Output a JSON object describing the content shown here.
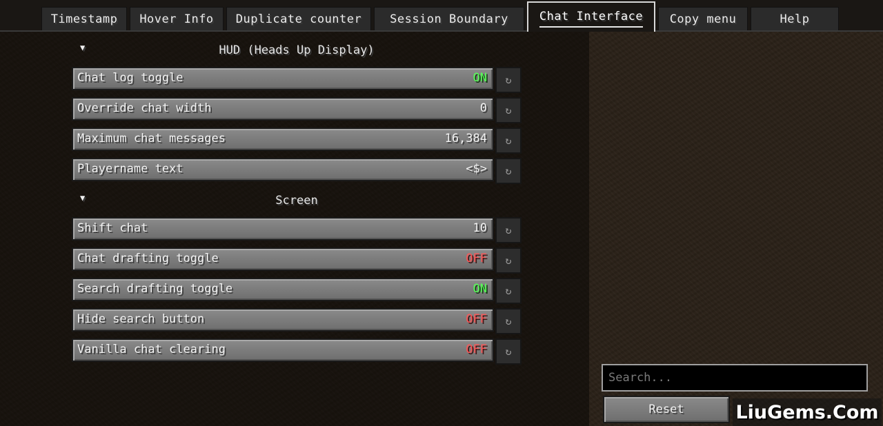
{
  "tabs": [
    {
      "label": "Timestamp"
    },
    {
      "label": "Hover Info"
    },
    {
      "label": "Duplicate counter"
    },
    {
      "label": "Session Boundary"
    },
    {
      "label": "Chat Interface"
    },
    {
      "label": "Copy menu"
    },
    {
      "label": "Help"
    }
  ],
  "active_tab": "Chat Interface",
  "sections": [
    {
      "title": "HUD (Heads Up Display)",
      "options": [
        {
          "label": "Chat log toggle",
          "value": "ON",
          "state": "on"
        },
        {
          "label": "Override chat width",
          "value": "0",
          "state": "plain"
        },
        {
          "label": "Maximum chat messages",
          "value": "16,384",
          "state": "plain"
        },
        {
          "label": "Playername text",
          "value": "<$>",
          "state": "plain"
        }
      ]
    },
    {
      "title": "Screen",
      "options": [
        {
          "label": "Shift chat",
          "value": "10",
          "state": "plain"
        },
        {
          "label": "Chat drafting toggle",
          "value": "OFF",
          "state": "off"
        },
        {
          "label": "Search drafting toggle",
          "value": "ON",
          "state": "on"
        },
        {
          "label": "Hide search button",
          "value": "OFF",
          "state": "off"
        },
        {
          "label": "Vanilla chat clearing",
          "value": "OFF",
          "state": "off"
        }
      ]
    }
  ],
  "icons": {
    "collapse": "triangle-down-icon",
    "reset": "reset-icon"
  },
  "search": {
    "placeholder": "Search..."
  },
  "buttons": {
    "reset_label": "Reset"
  },
  "watermark": {
    "text": "LiuGems.Com"
  },
  "colors": {
    "on": "#55ff55",
    "off": "#ff5555"
  }
}
